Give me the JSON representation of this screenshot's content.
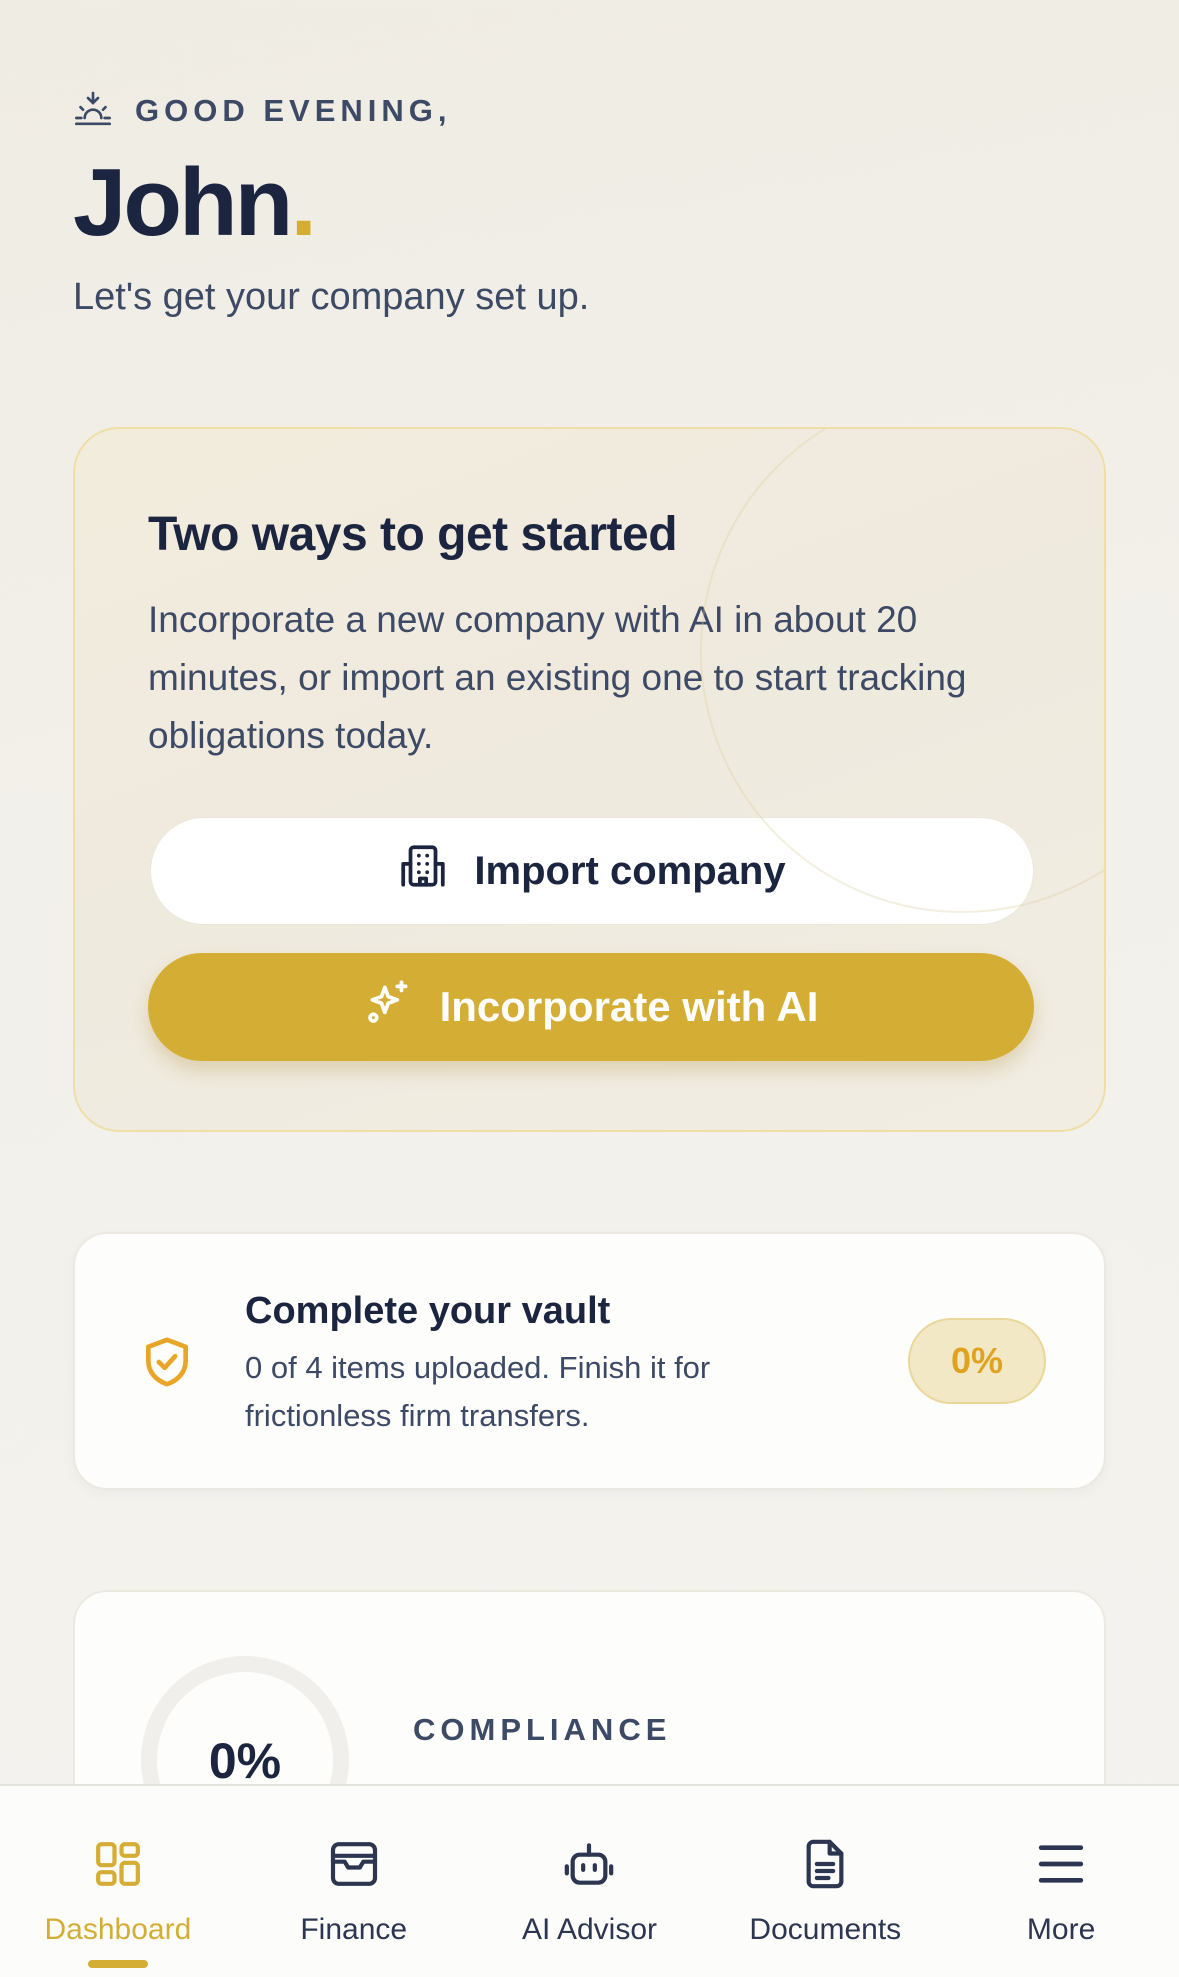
{
  "greeting": {
    "kicker": "GOOD EVENING,",
    "name": "John",
    "name_dot": ".",
    "subtitle": "Let's get your company set up."
  },
  "start_card": {
    "title": "Two ways to get started",
    "description": "Incorporate a new company with AI in about 20 minutes, or import an existing one to start tracking obligations today.",
    "import_label": "Import company",
    "ai_label": "Incorporate with AI"
  },
  "vault": {
    "title": "Complete your vault",
    "description": "0 of 4 items uploaded. Finish it for frictionless firm transfers.",
    "progress": "0%"
  },
  "compliance": {
    "value": "0%",
    "label": "COMPLIANCE"
  },
  "nav": {
    "items": [
      {
        "label": "Dashboard",
        "icon": "dashboard-icon",
        "active": true
      },
      {
        "label": "Finance",
        "icon": "wallet-icon"
      },
      {
        "label": "AI Advisor",
        "icon": "robot-icon"
      },
      {
        "label": "Documents",
        "icon": "document-icon"
      },
      {
        "label": "More",
        "icon": "menu-icon"
      }
    ]
  },
  "colors": {
    "accent": "#d4ad35",
    "text": "#1c2540",
    "muted": "#3d4a66",
    "badge_text": "#e0a321"
  }
}
